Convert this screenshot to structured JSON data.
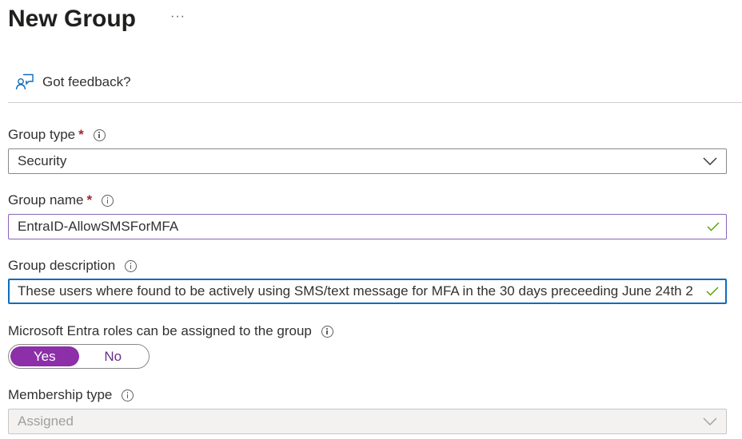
{
  "header": {
    "title": "New Group",
    "more_label": "···"
  },
  "feedback": {
    "label": "Got feedback?"
  },
  "group_type": {
    "label": "Group type",
    "required_mark": "*",
    "value": "Security"
  },
  "group_name": {
    "label": "Group name",
    "required_mark": "*",
    "value": "EntraID-AllowSMSForMFA"
  },
  "group_description": {
    "label": "Group description",
    "value": "These users where found to be actively using SMS/text message for MFA in the 30 days preceeding June 24th 2"
  },
  "roles_assignable": {
    "label": "Microsoft Entra roles can be assigned to the group",
    "options": [
      "Yes",
      "No"
    ],
    "selected": "Yes"
  },
  "membership_type": {
    "label": "Membership type",
    "value": "Assigned"
  },
  "colors": {
    "accent": "#8c2fa8",
    "required": "#a4262c",
    "valid_check": "#57a300",
    "focus_border": "#0f6cbd"
  }
}
